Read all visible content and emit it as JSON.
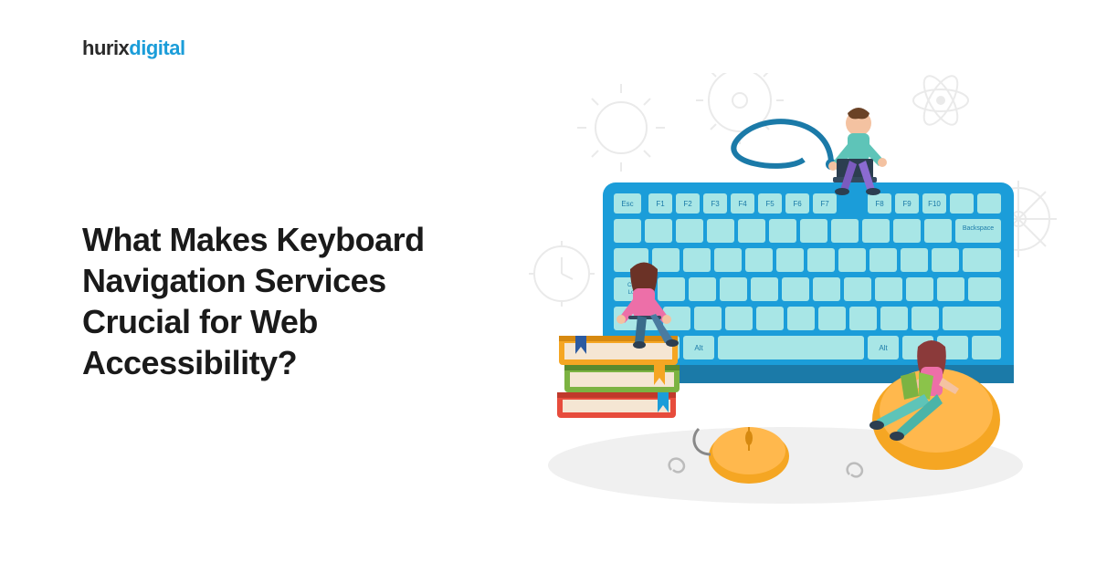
{
  "logo": {
    "part1": "hurix",
    "part2": "digital"
  },
  "headline": "What Makes Keyboard Navigation Services Crucial for Web Accessibility?",
  "illustration": {
    "keyboard_keys": {
      "top_row": [
        "Esc",
        "F1",
        "F2",
        "F3",
        "F4",
        "F5",
        "F6",
        "F7",
        "F8",
        "F9",
        "F10"
      ],
      "special": [
        "Backspace",
        "Caps Lock",
        "Alt",
        "Alt"
      ]
    },
    "colors": {
      "keyboard_frame": "#1b9dd9",
      "key_face": "#a8e6e6",
      "accent_orange": "#f5a623",
      "accent_red": "#e74c3c",
      "accent_green": "#7cb342",
      "gear_gray": "#d0d0d0"
    }
  }
}
